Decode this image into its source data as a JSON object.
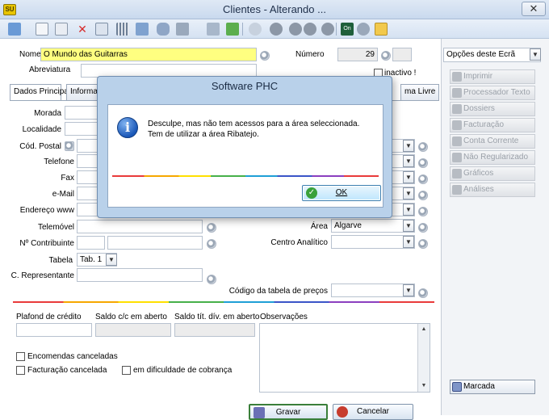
{
  "window": {
    "title": "Clientes - Alterando ...",
    "app_badge": "SU",
    "close_glyph": "✕"
  },
  "toolbar": {
    "icons": [
      "search-icon",
      "new-doc-icon",
      "copy-icon",
      "delete-icon",
      "duplicate-icon",
      "grid-icon",
      "folder-icon",
      "database-icon",
      "network-icon",
      "sign-icon",
      "refresh-icon",
      "preview-icon",
      "first-record-icon",
      "prev-record-icon",
      "next-record-icon",
      "last-record-icon",
      "on-icon",
      "settings-icon",
      "attach-icon"
    ],
    "on_label": "On"
  },
  "form": {
    "nome": {
      "label": "Nome",
      "value": "O Mundo das Guitarras"
    },
    "numero": {
      "label": "Número",
      "value": "29"
    },
    "abreviatura": {
      "label": "Abreviatura",
      "value": ""
    },
    "inactivo": {
      "label": "inactivo !"
    },
    "tabs": [
      {
        "label": "Dados Principais"
      },
      {
        "label": "Informações"
      },
      {
        "label": "ma Livre"
      }
    ],
    "fields": {
      "morada": "Morada",
      "localidade": "Localidade",
      "cod_postal": "Cód. Postal",
      "telefone": "Telefone",
      "fax": "Fax",
      "email": "e-Mail",
      "endereco_www": "Endereço www",
      "telemovel": "Telemóvel",
      "contribuinte": "Nº Contribuinte",
      "tabela": {
        "label": "Tabela",
        "value": "Tab. 1"
      },
      "c_representante": "C. Representante",
      "area": {
        "label": "Área",
        "value": "Algarve"
      },
      "centro_analitico": "Centro Analítico",
      "codigo_tabela_precos": "Código da tabela de preços"
    },
    "credit": {
      "plafond": "Plafond de crédito",
      "saldo_cc": "Saldo c/c em aberto",
      "saldo_tit": "Saldo tít. dív. em aberto",
      "observacoes": "Observações"
    },
    "checks": {
      "encomendas": "Encomendas canceladas",
      "facturacao": "Facturação cancelada",
      "dificuldade": "em dificuldade de cobrança"
    },
    "buttons": {
      "gravar": "Gravar",
      "cancelar": "Cancelar"
    }
  },
  "right_panel": {
    "dropdown": "Opções deste Ecrã",
    "items": [
      "Imprimir",
      "Processador Texto",
      "Dossiers",
      "Facturação",
      "Conta Corrente",
      "Não Regularizado",
      "Gráficos",
      "Análises"
    ],
    "marcada": "Marcada"
  },
  "dialog": {
    "title": "Software PHC",
    "message": "Desculpe, mas não tem acessos para a área seleccionada. Tem de utilizar a área Ribatejo.",
    "ok": "OK",
    "info_glyph": "i"
  }
}
